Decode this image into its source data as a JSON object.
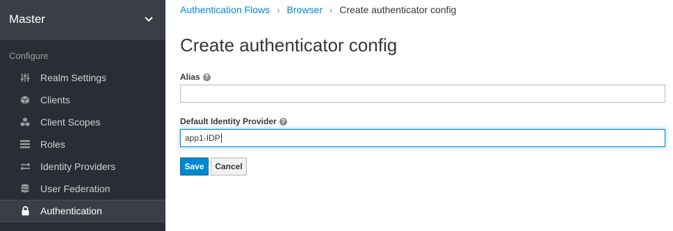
{
  "sidebar": {
    "realm": "Master",
    "section": "Configure",
    "items": [
      {
        "label": "Realm Settings",
        "icon": "sliders-icon"
      },
      {
        "label": "Clients",
        "icon": "cube-icon"
      },
      {
        "label": "Client Scopes",
        "icon": "cubes-icon"
      },
      {
        "label": "Roles",
        "icon": "list-icon"
      },
      {
        "label": "Identity Providers",
        "icon": "exchange-icon"
      },
      {
        "label": "User Federation",
        "icon": "database-icon"
      },
      {
        "label": "Authentication",
        "icon": "lock-icon",
        "active": true
      }
    ]
  },
  "breadcrumb": {
    "items": [
      "Authentication Flows",
      "Browser"
    ],
    "current": "Create authenticator config"
  },
  "page": {
    "title": "Create authenticator config"
  },
  "form": {
    "alias_label": "Alias",
    "alias_value": "",
    "idp_label": "Default Identity Provider",
    "idp_value": "app1-IDP",
    "save_label": "Save",
    "cancel_label": "Cancel"
  },
  "colors": {
    "sidebar_bg": "#292e34",
    "accent": "#0088ce"
  }
}
